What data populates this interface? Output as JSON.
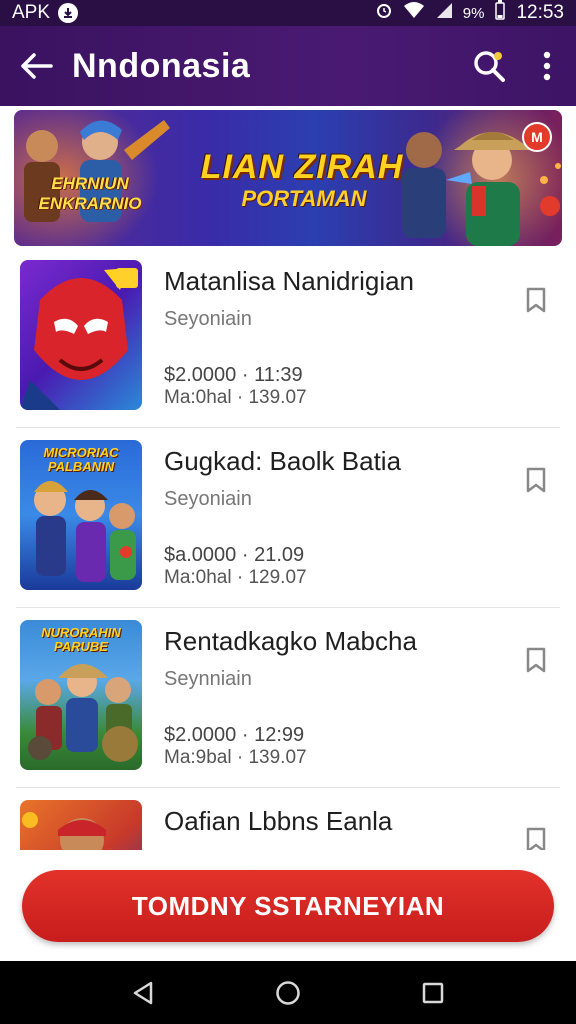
{
  "status_bar": {
    "carrier": "APK",
    "battery": "9%",
    "time": "12:53"
  },
  "app_bar": {
    "title": "Nndonasia"
  },
  "banner": {
    "title": "LIAN ZIRAH",
    "subtitle": "PORTAMAN",
    "left_text": "EHRNIUN ENKRARNIO",
    "badge": "M"
  },
  "items": [
    {
      "title": "Matanlisa Nanidrigian",
      "subtitle": "Seyoniain",
      "price": "$2.0000 · 11:39",
      "meta": "Ma:0hal · 139.07"
    },
    {
      "title": "Gugkad: Baolk Batia",
      "subtitle": "Seyoniain",
      "price": "$a.0000 · 21.09",
      "meta": "Ma:0hal · 129.07"
    },
    {
      "title": "Rentadkagko Mabcha",
      "subtitle": "Seynniain",
      "price": "$2.0000 · 12:99",
      "meta": "Ma:9bal · 139.07"
    },
    {
      "title": "Oafian Lbbns Eanla",
      "subtitle": "",
      "price": "",
      "meta": ""
    }
  ],
  "thumb_labels": [
    "",
    "MICRORIAC PALBANIN",
    "NURORAHIN PARUBE",
    ""
  ],
  "cta": {
    "label": "TOMDNY SSTARNEYIAN"
  },
  "colors": {
    "app_bar": "#4a1a72",
    "cta": "#d42623",
    "status_bar": "#2a0f44"
  }
}
